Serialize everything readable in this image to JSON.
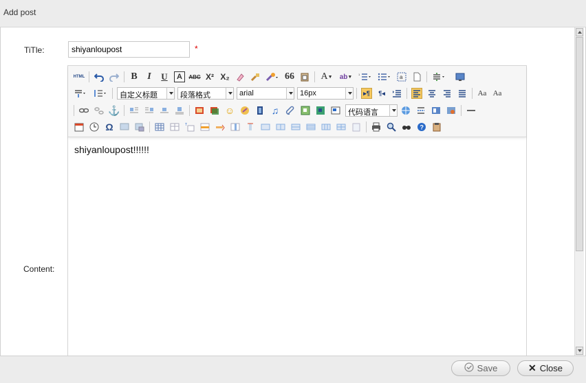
{
  "dialog": {
    "title": "Add post"
  },
  "form": {
    "title_label": "TiTle:",
    "title_value": "shiyanloupost",
    "required_mark": "*",
    "content_label": "Content:"
  },
  "toolbar": {
    "custom_heading": "自定义标题",
    "paragraph_format": "段落格式",
    "font_family": "arial",
    "font_size": "16px",
    "code_language": "代码语言",
    "html_label": "HTML"
  },
  "editor": {
    "content": "shiyanloupost!!!!!!"
  },
  "footer": {
    "save_label": "Save",
    "close_label": "Close"
  },
  "colors": {
    "header_bg": "#ececec",
    "required": "#dd0000"
  }
}
